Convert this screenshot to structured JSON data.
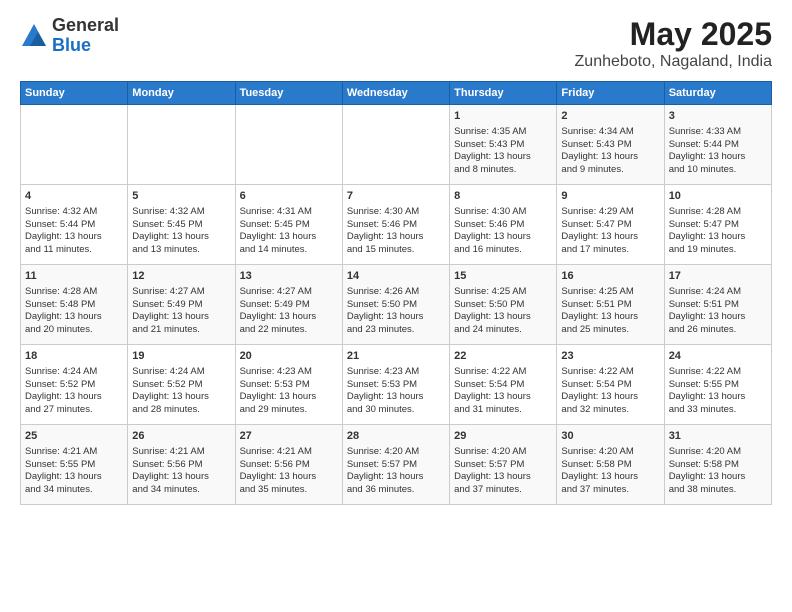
{
  "logo": {
    "general": "General",
    "blue": "Blue"
  },
  "title": "May 2025",
  "subtitle": "Zunheboto, Nagaland, India",
  "headers": [
    "Sunday",
    "Monday",
    "Tuesday",
    "Wednesday",
    "Thursday",
    "Friday",
    "Saturday"
  ],
  "weeks": [
    [
      {
        "day": "",
        "content": ""
      },
      {
        "day": "",
        "content": ""
      },
      {
        "day": "",
        "content": ""
      },
      {
        "day": "",
        "content": ""
      },
      {
        "day": "1",
        "content": "Sunrise: 4:35 AM\nSunset: 5:43 PM\nDaylight: 13 hours\nand 8 minutes."
      },
      {
        "day": "2",
        "content": "Sunrise: 4:34 AM\nSunset: 5:43 PM\nDaylight: 13 hours\nand 9 minutes."
      },
      {
        "day": "3",
        "content": "Sunrise: 4:33 AM\nSunset: 5:44 PM\nDaylight: 13 hours\nand 10 minutes."
      }
    ],
    [
      {
        "day": "4",
        "content": "Sunrise: 4:32 AM\nSunset: 5:44 PM\nDaylight: 13 hours\nand 11 minutes."
      },
      {
        "day": "5",
        "content": "Sunrise: 4:32 AM\nSunset: 5:45 PM\nDaylight: 13 hours\nand 13 minutes."
      },
      {
        "day": "6",
        "content": "Sunrise: 4:31 AM\nSunset: 5:45 PM\nDaylight: 13 hours\nand 14 minutes."
      },
      {
        "day": "7",
        "content": "Sunrise: 4:30 AM\nSunset: 5:46 PM\nDaylight: 13 hours\nand 15 minutes."
      },
      {
        "day": "8",
        "content": "Sunrise: 4:30 AM\nSunset: 5:46 PM\nDaylight: 13 hours\nand 16 minutes."
      },
      {
        "day": "9",
        "content": "Sunrise: 4:29 AM\nSunset: 5:47 PM\nDaylight: 13 hours\nand 17 minutes."
      },
      {
        "day": "10",
        "content": "Sunrise: 4:28 AM\nSunset: 5:47 PM\nDaylight: 13 hours\nand 19 minutes."
      }
    ],
    [
      {
        "day": "11",
        "content": "Sunrise: 4:28 AM\nSunset: 5:48 PM\nDaylight: 13 hours\nand 20 minutes."
      },
      {
        "day": "12",
        "content": "Sunrise: 4:27 AM\nSunset: 5:49 PM\nDaylight: 13 hours\nand 21 minutes."
      },
      {
        "day": "13",
        "content": "Sunrise: 4:27 AM\nSunset: 5:49 PM\nDaylight: 13 hours\nand 22 minutes."
      },
      {
        "day": "14",
        "content": "Sunrise: 4:26 AM\nSunset: 5:50 PM\nDaylight: 13 hours\nand 23 minutes."
      },
      {
        "day": "15",
        "content": "Sunrise: 4:25 AM\nSunset: 5:50 PM\nDaylight: 13 hours\nand 24 minutes."
      },
      {
        "day": "16",
        "content": "Sunrise: 4:25 AM\nSunset: 5:51 PM\nDaylight: 13 hours\nand 25 minutes."
      },
      {
        "day": "17",
        "content": "Sunrise: 4:24 AM\nSunset: 5:51 PM\nDaylight: 13 hours\nand 26 minutes."
      }
    ],
    [
      {
        "day": "18",
        "content": "Sunrise: 4:24 AM\nSunset: 5:52 PM\nDaylight: 13 hours\nand 27 minutes."
      },
      {
        "day": "19",
        "content": "Sunrise: 4:24 AM\nSunset: 5:52 PM\nDaylight: 13 hours\nand 28 minutes."
      },
      {
        "day": "20",
        "content": "Sunrise: 4:23 AM\nSunset: 5:53 PM\nDaylight: 13 hours\nand 29 minutes."
      },
      {
        "day": "21",
        "content": "Sunrise: 4:23 AM\nSunset: 5:53 PM\nDaylight: 13 hours\nand 30 minutes."
      },
      {
        "day": "22",
        "content": "Sunrise: 4:22 AM\nSunset: 5:54 PM\nDaylight: 13 hours\nand 31 minutes."
      },
      {
        "day": "23",
        "content": "Sunrise: 4:22 AM\nSunset: 5:54 PM\nDaylight: 13 hours\nand 32 minutes."
      },
      {
        "day": "24",
        "content": "Sunrise: 4:22 AM\nSunset: 5:55 PM\nDaylight: 13 hours\nand 33 minutes."
      }
    ],
    [
      {
        "day": "25",
        "content": "Sunrise: 4:21 AM\nSunset: 5:55 PM\nDaylight: 13 hours\nand 34 minutes."
      },
      {
        "day": "26",
        "content": "Sunrise: 4:21 AM\nSunset: 5:56 PM\nDaylight: 13 hours\nand 34 minutes."
      },
      {
        "day": "27",
        "content": "Sunrise: 4:21 AM\nSunset: 5:56 PM\nDaylight: 13 hours\nand 35 minutes."
      },
      {
        "day": "28",
        "content": "Sunrise: 4:20 AM\nSunset: 5:57 PM\nDaylight: 13 hours\nand 36 minutes."
      },
      {
        "day": "29",
        "content": "Sunrise: 4:20 AM\nSunset: 5:57 PM\nDaylight: 13 hours\nand 37 minutes."
      },
      {
        "day": "30",
        "content": "Sunrise: 4:20 AM\nSunset: 5:58 PM\nDaylight: 13 hours\nand 37 minutes."
      },
      {
        "day": "31",
        "content": "Sunrise: 4:20 AM\nSunset: 5:58 PM\nDaylight: 13 hours\nand 38 minutes."
      }
    ]
  ]
}
